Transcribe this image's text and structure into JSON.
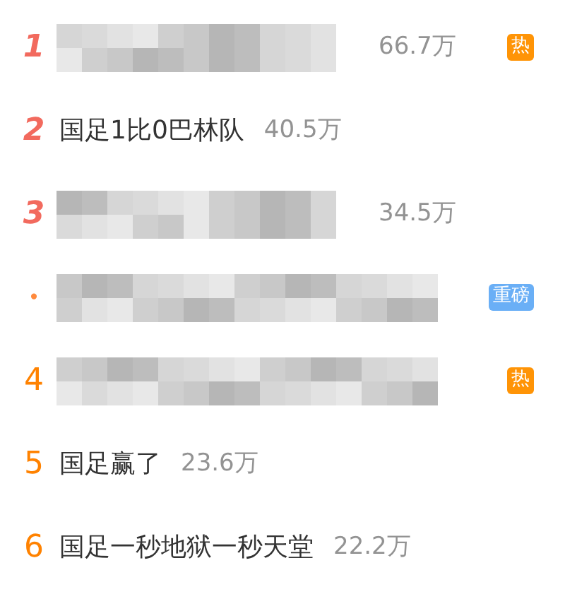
{
  "hot_list": [
    {
      "kind": "top",
      "rank": "1",
      "blurred_title": {
        "kind": "short"
      },
      "count": "66.7万",
      "badge": {
        "text": "热",
        "kind": "hot"
      }
    },
    {
      "kind": "top",
      "rank": "2",
      "title": "国足1比0巴林队",
      "count": "40.5万"
    },
    {
      "kind": "top",
      "rank": "3",
      "blurred_title": {
        "kind": "short"
      },
      "count": "34.5万"
    },
    {
      "kind": "promoted",
      "rank": "•",
      "blurred_title": {
        "kind": "long"
      },
      "badge": {
        "text": "重磅",
        "kind": "major"
      }
    },
    {
      "kind": "normal",
      "rank": "4",
      "blurred_title": {
        "kind": "long"
      },
      "badge": {
        "text": "热",
        "kind": "hot"
      }
    },
    {
      "kind": "normal",
      "rank": "5",
      "title": "国足赢了",
      "count": "23.6万"
    },
    {
      "kind": "normal",
      "rank": "6",
      "title": "国足一秒地狱一秒天堂",
      "count": "22.2万"
    }
  ]
}
